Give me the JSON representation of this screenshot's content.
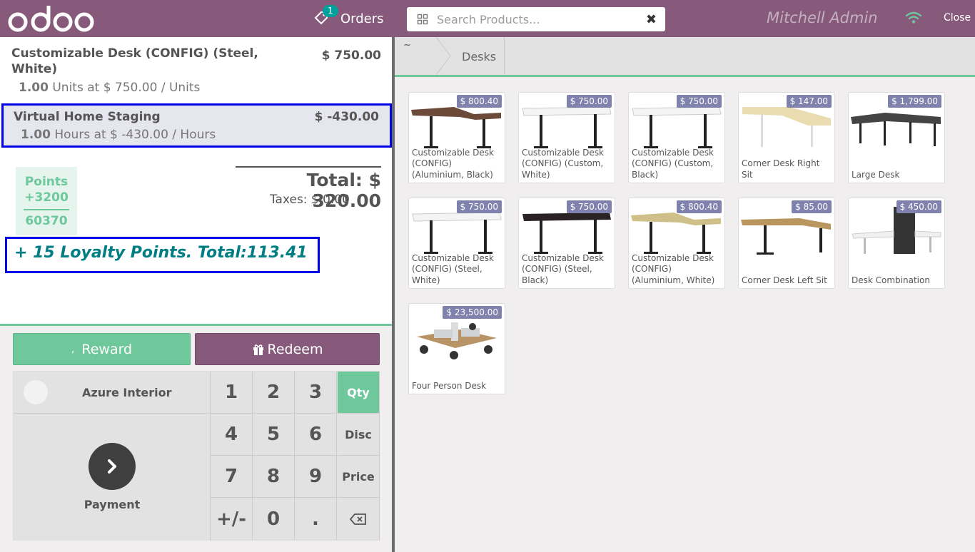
{
  "header": {
    "orders_label": "Orders",
    "orders_count": "1",
    "search_placeholder": "Search Products...",
    "cashier": "Mitchell Admin",
    "close_label": "Close"
  },
  "order": {
    "lines": [
      {
        "name": "Customizable Desk (CONFIG) (Steel, White)",
        "price": "$ 750.00",
        "qty": "1.00",
        "info": " Units at $ 750.00 / Units"
      },
      {
        "name": "Virtual Home Staging",
        "price": "$ -430.00",
        "qty": "1.00",
        "info": " Hours at $ -430.00 / Hours"
      }
    ],
    "total": "Total: $ 320.00",
    "taxes": "Taxes: $ 0.00",
    "points": {
      "label": "Points",
      "won": "+3200",
      "total": "60370"
    },
    "loyalty_banner": "+ 15 Loyalty Points. Total:113.41"
  },
  "actions": {
    "reward_label": "Reward",
    "redeem_label": "Redeem",
    "customer_name": "Azure Interior",
    "payment_label": "Payment"
  },
  "numpad": {
    "keys": [
      "1",
      "2",
      "3",
      "4",
      "5",
      "6",
      "7",
      "8",
      "9",
      "+/-",
      "0",
      "."
    ],
    "modes": [
      "Qty",
      "Disc",
      "Price"
    ],
    "active_mode": "Qty"
  },
  "breadcrumb": {
    "home": "~",
    "category": "Desks"
  },
  "colors": {
    "brand": "#875a7b",
    "accent_green": "#6ec89b",
    "price_tag": "#7f82ac",
    "selection_outline": "#0000e6"
  },
  "products": [
    {
      "name": "Customizable Desk (CONFIG) (Aluminium, Black)",
      "price": "$ 800.40"
    },
    {
      "name": "Customizable Desk (CONFIG) (Custom, White)",
      "price": "$ 750.00"
    },
    {
      "name": "Customizable Desk (CONFIG) (Custom, Black)",
      "price": "$ 750.00"
    },
    {
      "name": "Corner Desk Right Sit",
      "price": "$ 147.00"
    },
    {
      "name": "Large Desk",
      "price": "$ 1,799.00"
    },
    {
      "name": "Customizable Desk (CONFIG) (Steel, White)",
      "price": "$ 750.00"
    },
    {
      "name": "Customizable Desk (CONFIG) (Steel, Black)",
      "price": "$ 750.00"
    },
    {
      "name": "Customizable Desk (CONFIG) (Aluminium, White)",
      "price": "$ 800.40"
    },
    {
      "name": "Corner Desk Left Sit",
      "price": "$ 85.00"
    },
    {
      "name": "Desk Combination",
      "price": "$ 450.00"
    },
    {
      "name": "Four Person Desk",
      "price": "$ 23,500.00"
    }
  ]
}
